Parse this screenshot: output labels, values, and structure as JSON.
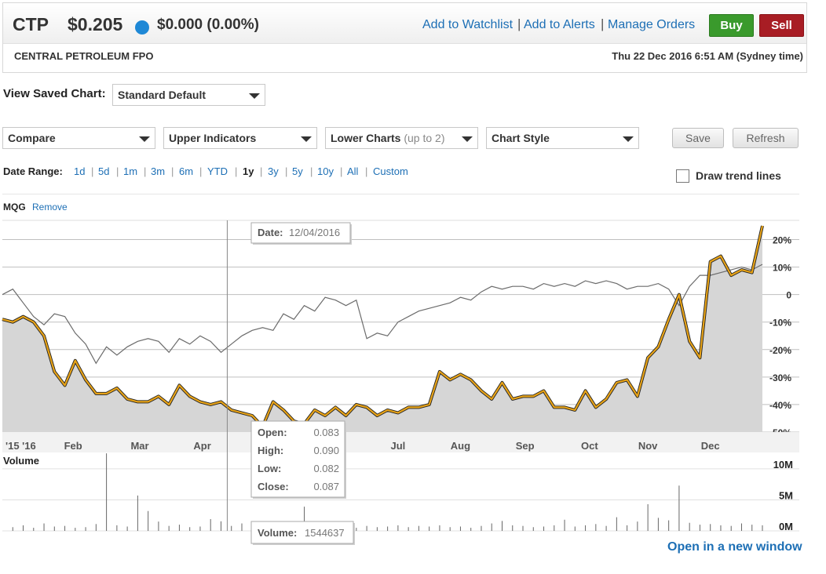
{
  "quote": {
    "symbol": "CTP",
    "price": "$0.205",
    "change": "$0.000 (0.00%)",
    "company": "CENTRAL PETROLEUM FPO",
    "timestamp": "Thu 22 Dec 2016 6:51 AM (Sydney time)",
    "links": [
      "Add to Watchlist",
      "Add to Alerts",
      "Manage Orders"
    ],
    "buy_label": "Buy",
    "sell_label": "Sell",
    "colors": {
      "buy": "#3a9a2c",
      "sell": "#a81d24",
      "status_dot": "#1e88d6"
    }
  },
  "controls": {
    "saved_chart_label": "View Saved Chart:",
    "saved_chart_value": "Standard Default",
    "compare": "Compare",
    "upper_indicators": "Upper Indicators",
    "lower_charts": "Lower Charts",
    "lower_charts_hint": "(up to 2)",
    "chart_style": "Chart Style",
    "save": "Save",
    "refresh": "Refresh",
    "date_range_label": "Date Range:",
    "date_ranges": [
      "1d",
      "5d",
      "1m",
      "3m",
      "6m",
      "YTD",
      "1y",
      "3y",
      "5y",
      "10y",
      "All",
      "Custom"
    ],
    "active_range": "1y",
    "draw_trend_label": "Draw trend lines",
    "draw_trend_checked": false,
    "compare_symbol": "MQG",
    "compare_remove": "Remove",
    "open_new_window": "Open in a new window"
  },
  "chart_data": [
    {
      "type": "line",
      "title": "",
      "y_unit": "%",
      "x_ticks": [
        "'15 '16",
        "Feb",
        "Mar",
        "Apr",
        "May",
        "Jun",
        "Jul",
        "Aug",
        "Sep",
        "Oct",
        "Nov",
        "Dec"
      ],
      "y_ticks": [
        "20%",
        "10%",
        "0",
        "-10%",
        "-20%",
        "-30%",
        "-40%",
        "-50%"
      ],
      "ylim": [
        -50,
        27
      ],
      "grid": true,
      "colors": {
        "ctp": "#e8a317",
        "mqg": "#6b6b6b",
        "area": "#d6d6d6"
      },
      "series": [
        {
          "name": "CTP",
          "x_day": [
            0,
            5,
            10,
            15,
            20,
            25,
            30,
            35,
            40,
            45,
            50,
            55,
            60,
            65,
            70,
            75,
            80,
            85,
            90,
            95,
            100,
            105,
            110,
            115,
            120,
            125,
            130,
            135,
            140,
            145,
            150,
            155,
            160,
            165,
            170,
            175,
            180,
            185,
            190,
            195,
            200,
            205,
            210,
            215,
            220,
            225,
            230,
            235,
            240,
            245,
            250,
            255,
            260,
            265,
            270,
            275,
            280,
            285,
            290,
            295,
            300,
            305,
            310,
            315,
            320,
            325,
            330,
            335,
            340,
            345,
            350,
            355,
            360,
            365
          ],
          "values": [
            -9,
            -10,
            -8,
            -10,
            -15,
            -28,
            -33,
            -24,
            -31,
            -36,
            -36,
            -34,
            -38,
            -39,
            -39,
            -37,
            -40,
            -33,
            -37,
            -39,
            -40,
            -39,
            -42,
            -43,
            -44,
            -48,
            -39,
            -42,
            -46,
            -47,
            -42,
            -44,
            -41,
            -44,
            -40,
            -41,
            -44,
            -42,
            -43,
            -41,
            -41,
            -40,
            -28,
            -31,
            -29,
            -31,
            -35,
            -38,
            -32,
            -38,
            -37,
            -37,
            -35,
            -41,
            -41,
            -42,
            -35,
            -41,
            -38,
            -32,
            -31,
            -37,
            -23,
            -19,
            -9,
            0,
            -17,
            -23,
            12,
            14,
            7,
            9,
            8,
            25
          ],
          "tooltip": {
            "date_label": "Date:",
            "date": "12/04/2016",
            "open_label": "Open:",
            "open": "0.083",
            "high_label": "High:",
            "high": "0.090",
            "low_label": "Low:",
            "low": "0.082",
            "close_label": "Close:",
            "close": "0.087",
            "volume_label": "Volume:",
            "volume": "1544637",
            "x_day": 108
          }
        },
        {
          "name": "MQG",
          "x_day": [
            0,
            5,
            10,
            15,
            20,
            25,
            30,
            35,
            40,
            45,
            50,
            55,
            60,
            65,
            70,
            75,
            80,
            85,
            90,
            95,
            100,
            105,
            110,
            115,
            120,
            125,
            130,
            135,
            140,
            145,
            150,
            155,
            160,
            165,
            170,
            175,
            180,
            185,
            190,
            195,
            200,
            205,
            210,
            215,
            220,
            225,
            230,
            235,
            240,
            245,
            250,
            255,
            260,
            265,
            270,
            275,
            280,
            285,
            290,
            295,
            300,
            305,
            310,
            315,
            320,
            325,
            330,
            335,
            340,
            345,
            350,
            355,
            360,
            365
          ],
          "values": [
            0,
            2,
            -3,
            -8,
            -11,
            -7,
            -8,
            -14,
            -18,
            -25,
            -19,
            -22,
            -19,
            -17,
            -16,
            -17,
            -21,
            -16,
            -18,
            -15,
            -17,
            -21,
            -18,
            -15,
            -13,
            -12,
            -13,
            -7,
            -9,
            -4,
            -6,
            -1,
            -2,
            -4,
            -2,
            -16,
            -14,
            -15,
            -10,
            -8,
            -6,
            -5,
            -4,
            -3,
            -1,
            -2,
            1,
            3,
            2,
            3,
            3,
            2,
            4,
            3,
            4,
            3,
            5,
            4,
            5,
            4,
            2,
            3,
            3,
            4,
            2,
            -4,
            3,
            7,
            7,
            8,
            9,
            10,
            9,
            11
          ]
        }
      ]
    },
    {
      "type": "bar",
      "title": "Volume",
      "y_ticks": [
        "10M",
        "5M",
        "0M"
      ],
      "ylim": [
        0,
        11000000
      ],
      "x_day": [
        5,
        10,
        15,
        20,
        25,
        30,
        35,
        40,
        45,
        50,
        55,
        60,
        65,
        70,
        75,
        80,
        85,
        90,
        95,
        100,
        105,
        110,
        115,
        120,
        125,
        130,
        135,
        140,
        145,
        150,
        155,
        160,
        165,
        170,
        175,
        180,
        185,
        190,
        195,
        200,
        205,
        210,
        215,
        220,
        225,
        230,
        235,
        240,
        245,
        250,
        255,
        260,
        265,
        270,
        275,
        280,
        285,
        290,
        295,
        300,
        305,
        310,
        315,
        320,
        325,
        330,
        335,
        340,
        345,
        350,
        355,
        360,
        365
      ],
      "values": [
        600000,
        900000,
        500000,
        1200000,
        700000,
        800000,
        500000,
        600000,
        1100000,
        12500000,
        900000,
        700000,
        5700000,
        3200000,
        1500000,
        800000,
        1000000,
        600000,
        700000,
        1900000,
        1544637,
        800000,
        1200000,
        900000,
        600000,
        800000,
        700000,
        1100000,
        3900000,
        800000,
        600000,
        700000,
        900000,
        500000,
        800000,
        600000,
        700000,
        900000,
        600000,
        800000,
        700000,
        900000,
        600000,
        700000,
        500000,
        800000,
        1200000,
        1600000,
        900000,
        800000,
        600000,
        700000,
        900000,
        1800000,
        700000,
        900000,
        1100000,
        800000,
        2200000,
        900000,
        1500000,
        4300000,
        2100000,
        1700000,
        7300000,
        1300000,
        1000000,
        1100000,
        900000,
        800000,
        1200000,
        1000000,
        900000
      ]
    }
  ]
}
